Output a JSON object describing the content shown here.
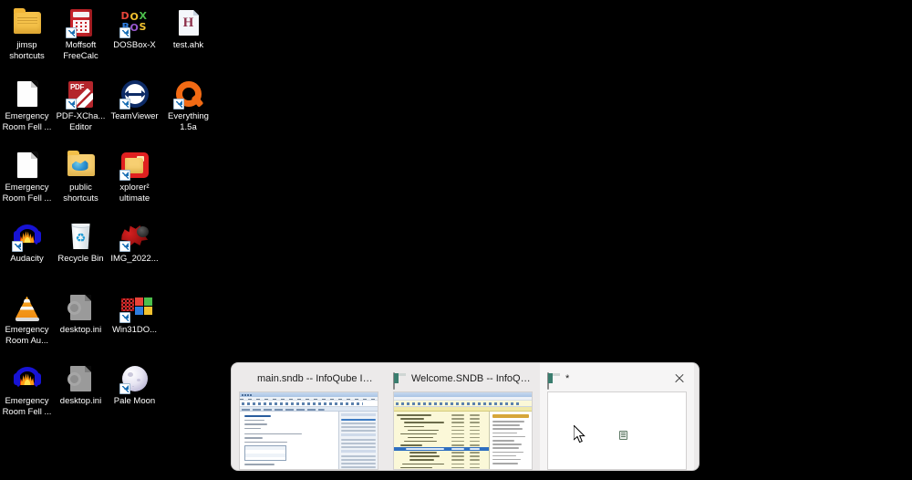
{
  "desktop": {
    "background_color": "#000000",
    "icons": [
      {
        "label": "jimsp shortcuts",
        "art": "folder",
        "icon_name": "folder-icon",
        "shortcut": false
      },
      {
        "label": "Moffsoft FreeCalc",
        "art": "calc",
        "icon_name": "calculator-icon",
        "shortcut": true
      },
      {
        "label": "DOSBox-X",
        "art": "dos",
        "icon_name": "dosbox-icon",
        "shortcut": true
      },
      {
        "label": "test.ahk",
        "art": "doch",
        "icon_name": "autohotkey-script-icon",
        "shortcut": false
      },
      {
        "label": "Emergency Room Fell ...",
        "art": "doc",
        "icon_name": "document-icon",
        "shortcut": false
      },
      {
        "label": "PDF-XCha... Editor",
        "art": "pdf",
        "icon_name": "pdf-editor-icon",
        "shortcut": true
      },
      {
        "label": "TeamViewer",
        "art": "tv",
        "icon_name": "teamviewer-icon",
        "shortcut": true
      },
      {
        "label": "Everything 1.5a",
        "art": "ever",
        "icon_name": "everything-search-icon",
        "shortcut": true
      },
      {
        "label": "Emergency Room Fell ...",
        "art": "doc",
        "icon_name": "document-icon",
        "shortcut": false
      },
      {
        "label": "public shortcuts",
        "art": "folderpub",
        "icon_name": "public-folder-icon",
        "shortcut": false
      },
      {
        "label": "xplorer² ultimate",
        "art": "xp",
        "icon_name": "xplorer2-icon",
        "shortcut": true
      },
      {
        "label": "Audacity",
        "art": "aud",
        "icon_name": "audacity-icon",
        "shortcut": true
      },
      {
        "label": "Recycle Bin",
        "art": "rec",
        "icon_name": "recycle-bin-icon",
        "shortcut": false
      },
      {
        "label": "IMG_2022...",
        "art": "img",
        "icon_name": "image-file-icon",
        "shortcut": true
      },
      {
        "label": "Emergency Room Au...",
        "art": "vlc",
        "icon_name": "vlc-media-icon",
        "shortcut": false
      },
      {
        "label": "desktop.ini",
        "art": "ini",
        "icon_name": "ini-config-file-icon",
        "shortcut": false
      },
      {
        "label": "Win31DO...",
        "art": "win31",
        "icon_name": "windows31-icon",
        "shortcut": true
      },
      {
        "label": "Emergency Room Fell ...",
        "art": "aud",
        "icon_name": "audacity-project-icon",
        "shortcut": false
      },
      {
        "label": "desktop.ini",
        "art": "ini",
        "icon_name": "ini-config-file-icon",
        "shortcut": false
      },
      {
        "label": "Pale Moon",
        "art": "moon",
        "icon_name": "pale-moon-browser-icon",
        "shortcut": true
      }
    ]
  },
  "switcher": {
    "background_color": "#eceaea",
    "selected_index": 2,
    "close_icon": "close-icon",
    "items": [
      {
        "title": "main.sndb -- InfoQube IM -- H...",
        "icon_name": "infoqube-cube-icon",
        "thumbnail": "document-editor",
        "selected": false,
        "has_close": false
      },
      {
        "title": "Welcome.SNDB -- InfoQube IM...",
        "icon_name": "infoqube-window-icon",
        "thumbnail": "grid-outliner",
        "selected": false,
        "has_close": false
      },
      {
        "title": "*",
        "icon_name": "infoqube-window-icon",
        "thumbnail": "empty-window",
        "selected": true,
        "has_close": true
      }
    ]
  }
}
